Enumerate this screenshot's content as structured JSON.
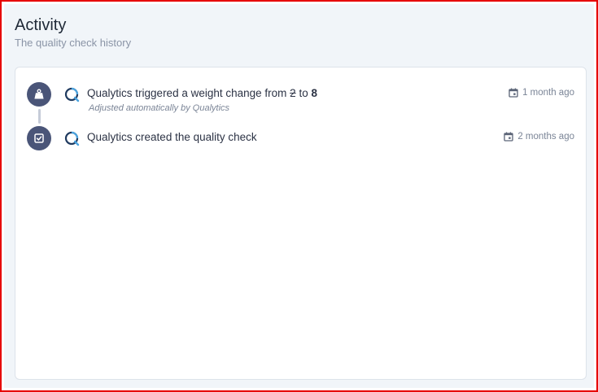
{
  "header": {
    "title": "Activity",
    "subtitle": "The quality check history"
  },
  "events": [
    {
      "icon": "weight-icon",
      "actor": "Qualytics",
      "action": "triggered a weight change from",
      "old_value": "2",
      "connector_word": "to",
      "new_value": "8",
      "note": "Adjusted automatically by Qualytics",
      "time": "1 month ago"
    },
    {
      "icon": "check-square-icon",
      "actor": "Qualytics",
      "action": "created the quality check",
      "time": "2 months ago"
    }
  ],
  "colors": {
    "node": "#4a5578",
    "brand_dark": "#1f3a5f",
    "brand_light": "#4aa3df",
    "frame": "#e60000"
  }
}
